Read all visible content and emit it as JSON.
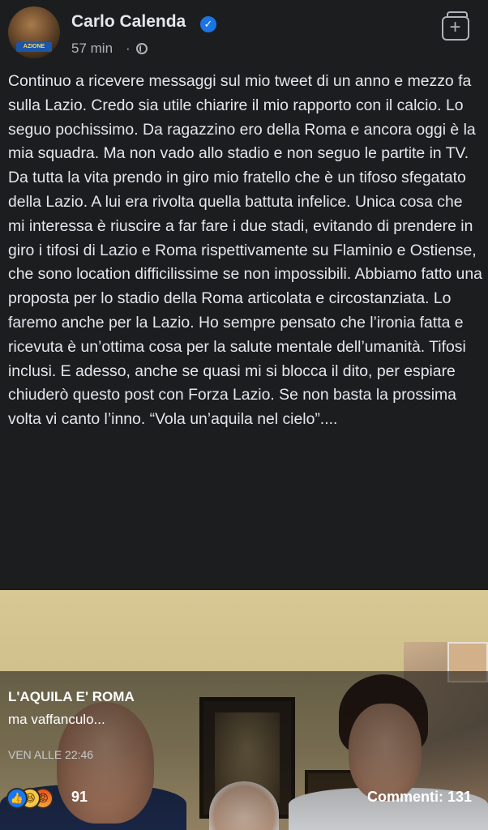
{
  "post": {
    "author": "Carlo Calenda",
    "time": "57 min",
    "separator": "·",
    "avatar_badge": "AZIONE",
    "text": "Continuo a ricevere messaggi sul mio tweet di un anno e mezzo fa sulla Lazio. Credo sia utile chiarire il mio rapporto con il calcio. Lo seguo pochissimo. Da ragazzino ero della Roma e ancora oggi è la mia squadra. Ma non vado allo stadio e non seguo le partite in TV. Da tutta la vita prendo in giro mio fratello che è un tifoso sfegatato della Lazio. A lui era rivolta quella battuta infelice. Unica cosa che mi interessa è riuscire a far fare i due stadi, evitando di prendere in giro i tifosi di Lazio e Roma rispettivamente su Flaminio e Ostiense, che sono location difficilissime se non impossibili. Abbiamo fatto una proposta per lo stadio della Roma articolata e circostanziata. Lo faremo anche per la Lazio. Ho sempre pensato che l’ironia fatta e ricevuta è un’ottima cosa per la salute mentale dell’umanità. Tifosi inclusi. E adesso, anche se quasi mi si blocca il dito, per espiare chiuderò questo post con Forza Lazio. Se non basta la prossima volta vi canto l’inno. “Vola un’aquila nel cielo”....",
    "icons": {
      "verified": "verified-badge-icon",
      "audience": "globe-icon",
      "save": "save-collection-icon"
    }
  },
  "comment": {
    "author": "L'AQUILA E' ROMA",
    "text": "ma vaffanculo...",
    "time": "VEN ALLE 22:46"
  },
  "footer": {
    "reaction_icons": [
      "like-icon",
      "haha-icon",
      "angry-icon"
    ],
    "reaction_count": "91",
    "comments_label": "Commenti: 131"
  },
  "colors": {
    "background": "#1c1d1f",
    "text": "#e4e6eb",
    "secondary": "#b0b3b8",
    "verified": "#1b74e4",
    "like": "#1877f2"
  }
}
